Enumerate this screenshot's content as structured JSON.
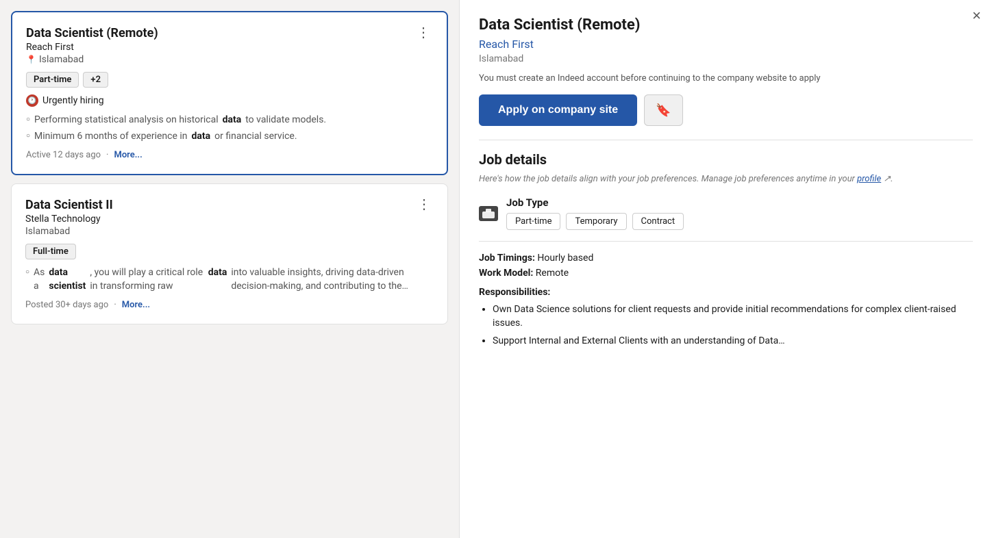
{
  "left": {
    "cards": [
      {
        "id": "card-1",
        "selected": true,
        "title": "Data Scientist (Remote)",
        "company": "Reach First",
        "location": "Islamabad",
        "tags": [
          "Part-time",
          "+2"
        ],
        "urgent": true,
        "urgent_label": "Urgently hiring",
        "bullets": [
          "Performing statistical analysis on historical <b>data</b> to validate models.",
          "Minimum 6 months of experience in <b>data</b> or financial service."
        ],
        "footer_time": "Active 12 days ago",
        "footer_more": "More..."
      },
      {
        "id": "card-2",
        "selected": false,
        "title": "Data Scientist II",
        "company": "Stella Technology",
        "location": "Islamabad",
        "tags": [
          "Full-time"
        ],
        "urgent": false,
        "urgent_label": "",
        "bullets": [
          "As a <b>data scientist</b>, you will play a critical role in transforming raw <b>data</b> into valuable insights, driving data-driven decision-making, and contributing to the…"
        ],
        "footer_time": "Posted 30+ days ago",
        "footer_more": "More..."
      }
    ]
  },
  "right": {
    "close_label": "×",
    "job_title": "Data Scientist (Remote)",
    "company": "Reach First",
    "location": "Islamabad",
    "warning": "You must create an Indeed account before continuing to the company website to apply",
    "apply_btn": "Apply on company site",
    "save_label": "🔖",
    "job_details_title": "Job details",
    "job_details_subtitle": "Here's how the job details align with your job preferences. Manage job preferences anytime in your",
    "profile_link": "profile",
    "job_type_label": "Job Type",
    "job_type_tags": [
      "Part-time",
      "Temporary",
      "Contract"
    ],
    "job_timings_label": "Job Timings:",
    "job_timings_value": "Hourly based",
    "work_model_label": "Work Model:",
    "work_model_value": "Remote",
    "responsibilities_label": "Responsibilities:",
    "responsibilities": [
      "Own Data Science solutions for client requests and provide initial recommendations for complex client-raised issues.",
      "Support Internal and External Clients with an understanding of Data…"
    ]
  }
}
